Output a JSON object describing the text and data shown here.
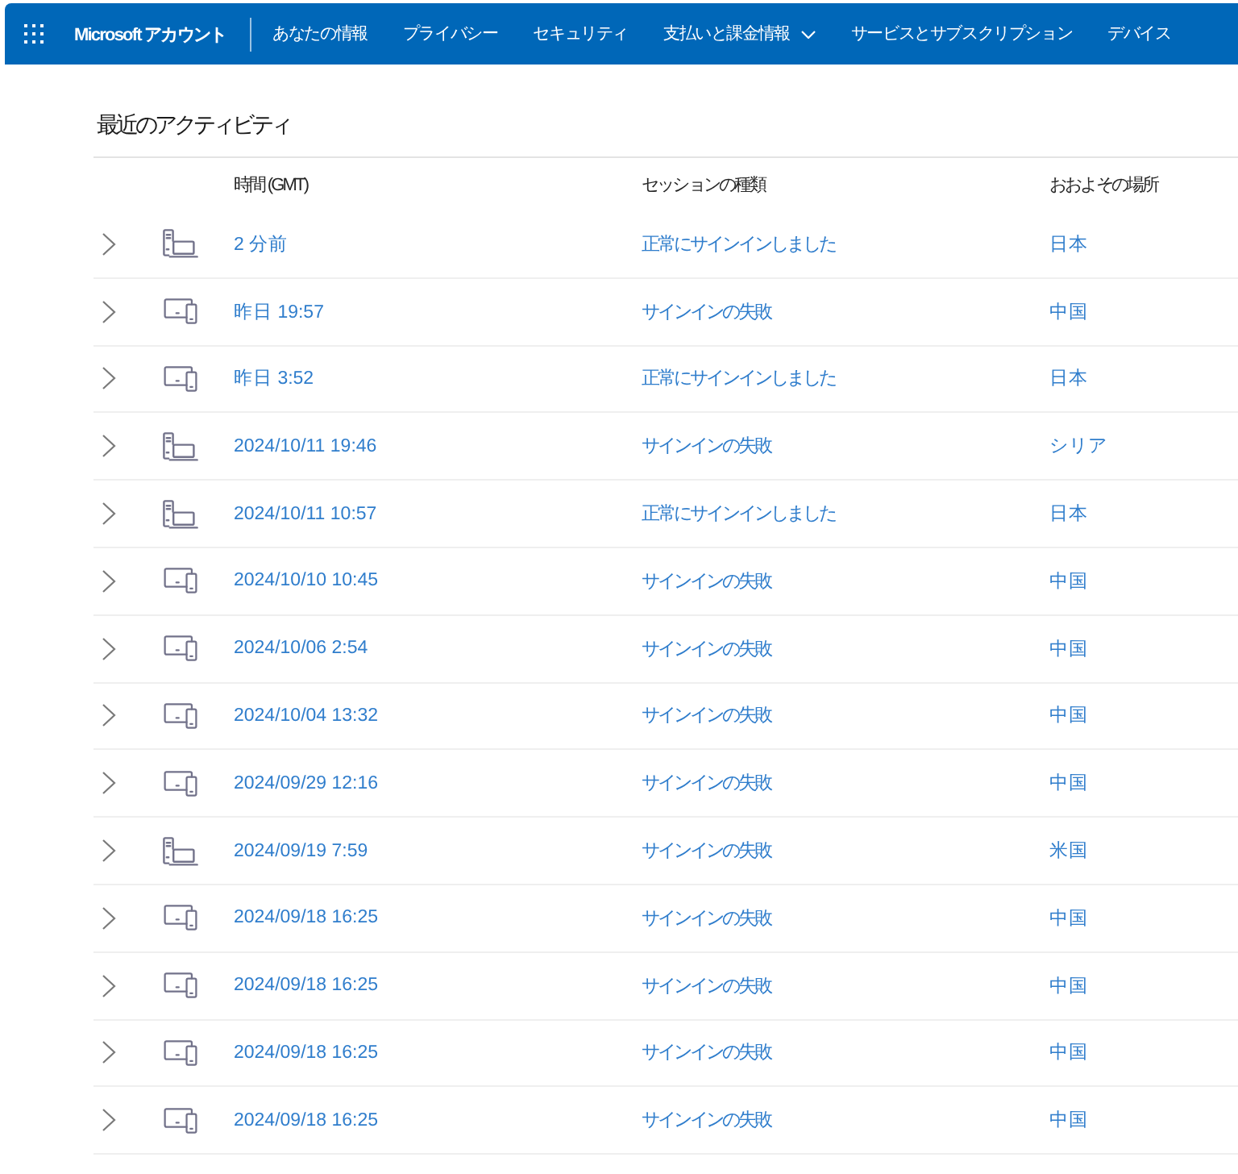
{
  "nav": {
    "brand": "Microsoft アカウント",
    "items": [
      {
        "label": "あなたの情報",
        "kind": "link"
      },
      {
        "label": "プライバシー",
        "kind": "link"
      },
      {
        "label": "セキュリティ",
        "kind": "link"
      },
      {
        "label": "支払いと課金情報",
        "kind": "menu"
      },
      {
        "label": "サービスとサブスクリプション",
        "kind": "link"
      },
      {
        "label": "デバイス",
        "kind": "link"
      }
    ]
  },
  "activity": {
    "title": "最近のアクティビティ",
    "columns": [
      "時間 (GMT)",
      "セッションの種類",
      "おおよその場所"
    ],
    "rows": [
      {
        "kind": "pc",
        "expanded": false,
        "time": "2 分前",
        "session": "正常にサインインしました",
        "location": "日本"
      },
      {
        "kind": "tablet_phone",
        "expanded": false,
        "time": "昨日 19:57",
        "session": "サインインの失敗",
        "location": "中国"
      },
      {
        "kind": "tablet_phone",
        "expanded": false,
        "time": "昨日 3:52",
        "session": "正常にサインインしました",
        "location": "日本"
      },
      {
        "kind": "pc",
        "expanded": false,
        "time": "2024/10/11 19:46",
        "session": "サインインの失敗",
        "location": "シリア"
      },
      {
        "kind": "pc",
        "expanded": false,
        "time": "2024/10/11 10:57",
        "session": "正常にサインインしました",
        "location": "日本"
      },
      {
        "kind": "tablet_phone",
        "expanded": false,
        "time": "2024/10/10 10:45",
        "session": "サインインの失敗",
        "location": "中国"
      },
      {
        "kind": "tablet_phone",
        "expanded": false,
        "time": "2024/10/06 2:54",
        "session": "サインインの失敗",
        "location": "中国"
      },
      {
        "kind": "tablet_phone",
        "expanded": false,
        "time": "2024/10/04 13:32",
        "session": "サインインの失敗",
        "location": "中国"
      },
      {
        "kind": "tablet_phone",
        "expanded": false,
        "time": "2024/09/29 12:16",
        "session": "サインインの失敗",
        "location": "中国"
      },
      {
        "kind": "pc",
        "expanded": false,
        "time": "2024/09/19 7:59",
        "session": "サインインの失敗",
        "location": "米国"
      },
      {
        "kind": "tablet_phone",
        "expanded": false,
        "time": "2024/09/18 16:25",
        "session": "サインインの失敗",
        "location": "中国"
      },
      {
        "kind": "tablet_phone",
        "expanded": false,
        "time": "2024/09/18 16:25",
        "session": "サインインの失敗",
        "location": "中国"
      },
      {
        "kind": "tablet_phone",
        "expanded": false,
        "time": "2024/09/18 16:25",
        "session": "サインインの失敗",
        "location": "中国"
      },
      {
        "kind": "tablet_phone",
        "expanded": false,
        "time": "2024/09/18 16:25",
        "session": "サインインの失敗",
        "location": "中国"
      }
    ]
  }
}
